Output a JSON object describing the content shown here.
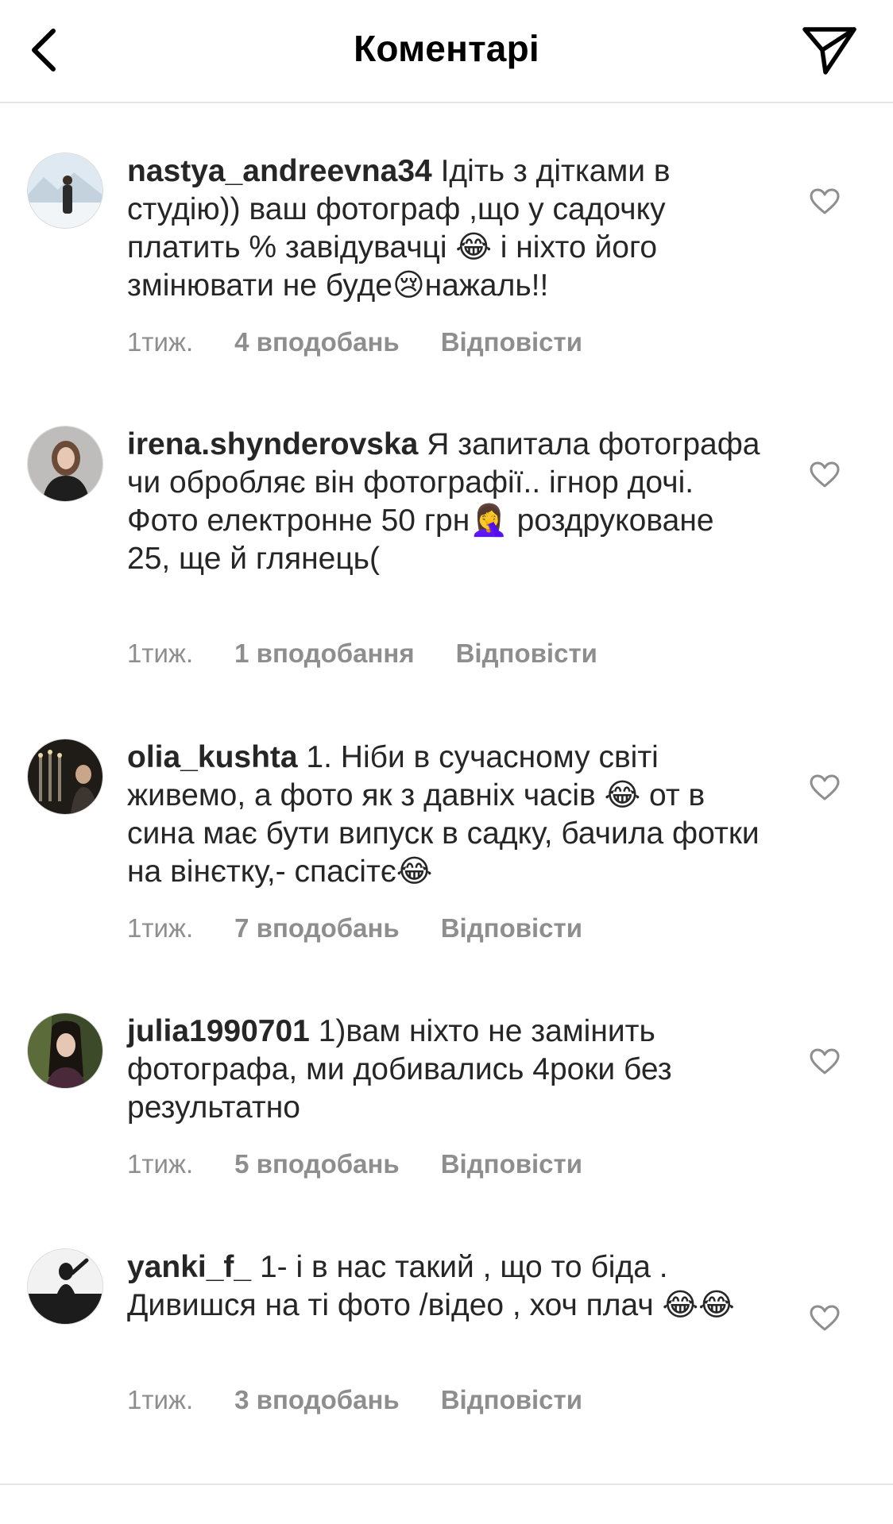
{
  "header": {
    "title": "Коментарі",
    "back_icon": "chevron-left-icon",
    "send_icon": "paper-plane-icon"
  },
  "comments": [
    {
      "username": "nastya_andreevna34",
      "text": " Ідіть з дітками в студію)) ваш фотограф ,що у садочку платить % завідувачці 😂 і ніхто його змінювати не буде😢нажаль!!",
      "time": "1тиж.",
      "likes": "4 вподобань",
      "reply": "Відповісти"
    },
    {
      "username": "irena.shynderovska",
      "text": " Я запитала фотографа чи обробляє він фотографії.. ігнор дочі. Фото електронне 50 грн🤦‍♀️ роздруковане 25, ще й глянець(",
      "time": "1тиж.",
      "likes": "1 вподобання",
      "reply": "Відповісти"
    },
    {
      "username": "olia_kushta",
      "text": " 1. Ніби в сучасному світі живемо, а фото як з давніх часів 😂 от в сина має бути випуск в садку, бачила фотки на вінєтку,- спасітє😂",
      "time": "1тиж.",
      "likes": "7 вподобань",
      "reply": "Відповісти"
    },
    {
      "username": "julia1990701",
      "text": " 1)вам ніхто не замінить фотографа, ми добивались 4роки без результатно",
      "time": "1тиж.",
      "likes": "5 вподобань",
      "reply": "Відповісти"
    },
    {
      "username": "yanki_f_",
      "text": " 1- і в нас такий , що то біда . Дивишся на ті фото /відео , хоч плач 😂😂",
      "time": "1тиж.",
      "likes": "3 вподобань",
      "reply": "Відповісти"
    }
  ],
  "icons": {
    "like": "heart-outline-icon"
  },
  "colors": {
    "text": "#262626",
    "meta": "#8e8e8e",
    "divider": "#e6e6e6"
  }
}
